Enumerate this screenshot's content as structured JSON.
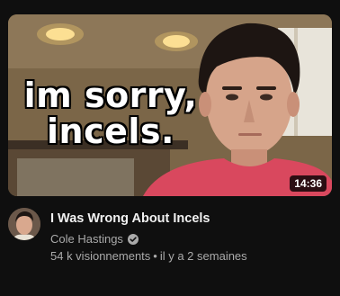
{
  "video": {
    "thumbnail_text_line1": "im sorry,",
    "thumbnail_text_line2": "incels.",
    "duration": "14:36",
    "title": "I Was Wrong About Incels",
    "channel": "Cole Hastings",
    "views": "54 k visionnements",
    "separator": "•",
    "age": "il y a 2 semaines"
  },
  "icons": {
    "verified": "verified-check-icon",
    "avatar": "channel-avatar"
  },
  "colors": {
    "background": "#0f0f0f",
    "title": "#f1f1f1",
    "secondary_text": "#aaaaaa",
    "shirt": "#d9485e"
  }
}
